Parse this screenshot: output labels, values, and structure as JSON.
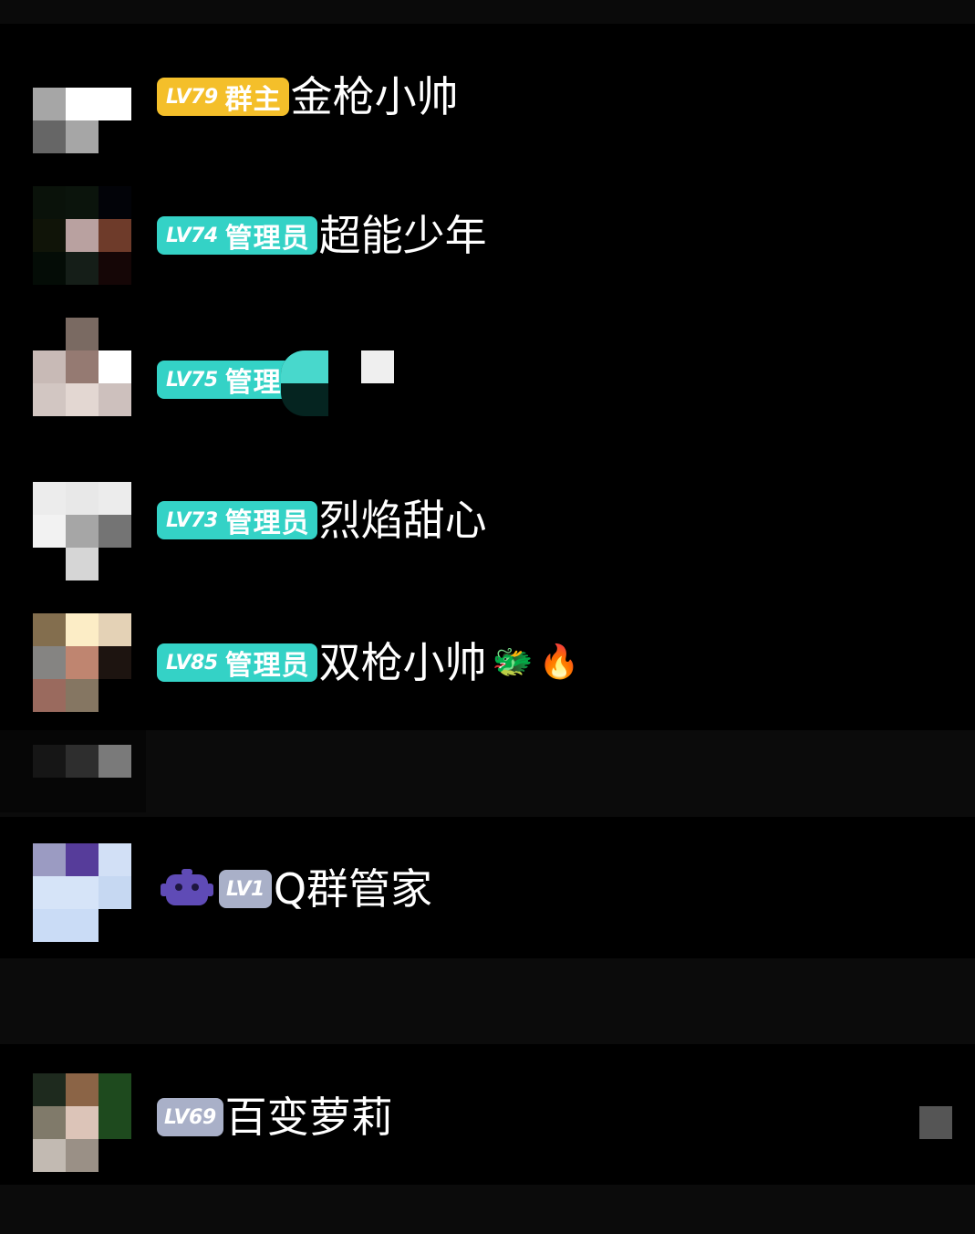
{
  "members": [
    {
      "level": "LV79",
      "role": "群主",
      "role_type": "owner",
      "nickname": "金枪小帅",
      "avatar_tiles": [
        "#000000",
        "#000000",
        "#000000",
        "#a6a6a6",
        "#ffffff",
        "#ffffff",
        "#666666",
        "#a6a6a6",
        "#000000"
      ]
    },
    {
      "level": "LV74",
      "role": "管理员",
      "role_type": "admin",
      "nickname": "超能少年",
      "avatar_tiles": [
        "#0a120a",
        "#0b140c",
        "#020308",
        "#101408",
        "#b9a1a0",
        "#6e3b2a",
        "#040c06",
        "#151e18",
        "#150606"
      ]
    },
    {
      "level": "LV75",
      "role": "管理员",
      "role_type": "admin",
      "nickname": "",
      "avatar_tiles": [
        "#000000",
        "#7a6a62",
        "#000000",
        "#c8bab6",
        "#957a72",
        "#ffffff",
        "#d2c6c2",
        "#e3d7d2",
        "#cdc0bd"
      ]
    },
    {
      "level": "LV73",
      "role": "管理员",
      "role_type": "admin",
      "nickname": "烈焰甜心",
      "avatar_tiles": [
        "#ececec",
        "#e8e8e8",
        "#ececec",
        "#f2f2f2",
        "#a6a6a6",
        "#747474",
        "#000000",
        "#d6d6d6",
        "#000000"
      ]
    },
    {
      "level": "LV85",
      "role": "管理员",
      "role_type": "admin",
      "nickname": "双枪小帅",
      "emojis": [
        "🐲",
        "🔥"
      ],
      "avatar_tiles": [
        "#836e4e",
        "#fcedc6",
        "#e4d2b6",
        "#858482",
        "#bf8570",
        "#1d1410",
        "#9a6a5e",
        "#857662",
        "#000000"
      ]
    },
    {
      "level": "LV1",
      "role": "",
      "role_type": "bot",
      "nickname": "Q群管家",
      "avatar_tiles": [
        "#9b9bc2",
        "#563c9a",
        "#d2e0f6",
        "#d6e4f8",
        "#d6e4f8",
        "#c6d8f2",
        "#cadcf6",
        "#cadcf6",
        "#000000"
      ]
    },
    {
      "level": "LV69",
      "role": "",
      "role_type": "member",
      "nickname": "百变萝莉",
      "avatar_tiles": [
        "#1e2a1e",
        "#8b6446",
        "#1e4a1e",
        "#807a6a",
        "#dcc4b8",
        "#1e4a1e",
        "#c2bab2",
        "#9a9086",
        "#000000"
      ]
    }
  ],
  "partial_row": {
    "avatar_tiles": [
      "#161616",
      "#2e2e2e",
      "#7a7a7a"
    ]
  },
  "colors": {
    "owner_badge": "#f4bf2a",
    "admin_badge": "#34d2c6",
    "level_badge": "#a9b0c8",
    "bot_icon": "#5f4bb6"
  },
  "icons": {
    "bot": "robot-icon"
  }
}
